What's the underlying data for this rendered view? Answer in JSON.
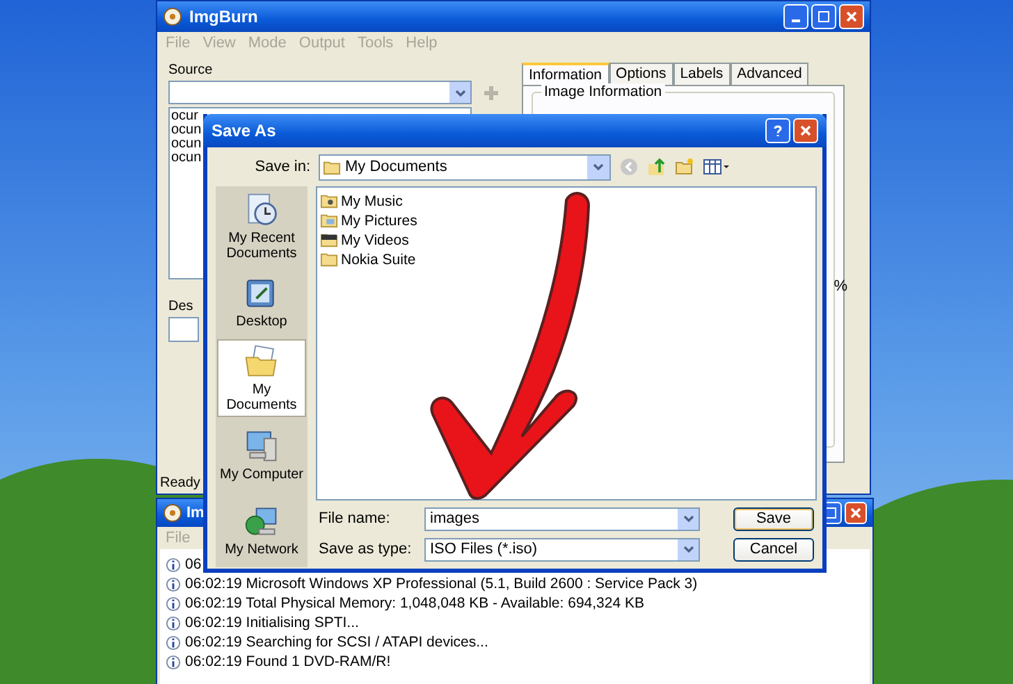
{
  "main_window": {
    "title": "ImgBurn",
    "menu": [
      {
        "label": "File",
        "disabled": true
      },
      {
        "label": "View",
        "disabled": true
      },
      {
        "label": "Mode",
        "disabled": true
      },
      {
        "label": "Output",
        "disabled": true
      },
      {
        "label": "Tools",
        "disabled": true
      },
      {
        "label": "Help",
        "disabled": true
      }
    ],
    "source_label": "Source",
    "source_list": [
      "ocur",
      "ocun",
      "ocun",
      "ocun"
    ],
    "tabs": [
      {
        "label": "Information",
        "selected": true
      },
      {
        "label": "Options",
        "selected": false
      },
      {
        "label": "Labels",
        "selected": false
      },
      {
        "label": "Advanced",
        "selected": false
      }
    ],
    "group_label": "Image Information",
    "description_label": "Des",
    "percent": "%",
    "status": "Ready"
  },
  "log_window": {
    "title": "Im",
    "menu": [
      {
        "label": "File",
        "disabled": true
      }
    ],
    "lines": [
      "06",
      "06:02:19 Microsoft Windows XP Professional (5.1, Build 2600 : Service Pack 3)",
      "06:02:19 Total Physical Memory: 1,048,048 KB  -  Available: 694,324 KB",
      "06:02:19 Initialising SPTI...",
      "06:02:19 Searching for SCSI / ATAPI devices...",
      "06:02:19 Found 1 DVD-RAM/R!"
    ]
  },
  "dialog": {
    "title": "Save As",
    "save_in_label": "Save in:",
    "save_in": "My Documents",
    "places": [
      {
        "label": "My Recent Documents",
        "kind": "recent",
        "selected": false
      },
      {
        "label": "Desktop",
        "kind": "desktop",
        "selected": false
      },
      {
        "label": "My Documents",
        "kind": "documents",
        "selected": true
      },
      {
        "label": "My Computer",
        "kind": "computer",
        "selected": false
      },
      {
        "label": "My Network",
        "kind": "network",
        "selected": false
      }
    ],
    "files": [
      {
        "name": "My Music",
        "kind": "music"
      },
      {
        "name": "My Pictures",
        "kind": "pictures"
      },
      {
        "name": "My Videos",
        "kind": "videos"
      },
      {
        "name": "Nokia Suite",
        "kind": "folder"
      }
    ],
    "file_name_label": "File name:",
    "file_name": "images",
    "type_label": "Save as type:",
    "type": "ISO Files (*.iso)",
    "buttons": [
      {
        "label": "Save",
        "kind": "default"
      },
      {
        "label": "Cancel",
        "kind": "normal"
      }
    ]
  }
}
